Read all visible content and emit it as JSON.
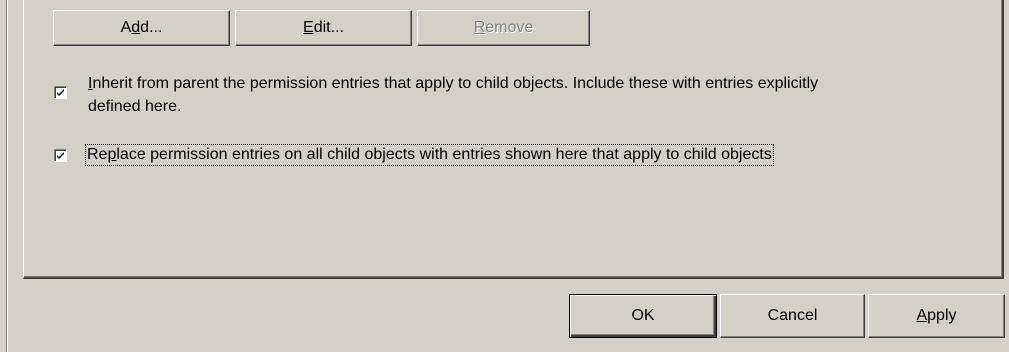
{
  "buttons": {
    "add": {
      "pre": "A",
      "acc": "d",
      "post": "d..."
    },
    "edit": {
      "pre": "",
      "acc": "E",
      "post": "dit..."
    },
    "remove": {
      "pre": "",
      "acc": "R",
      "post": "emove"
    }
  },
  "checkboxes": [
    {
      "checked": true,
      "line1_acc": "I",
      "line1_rest": "nherit from parent the permission entries that apply to child objects. Include these with entries explicitly",
      "line2": "defined here."
    },
    {
      "checked": true,
      "pre": "Re",
      "acc": "p",
      "post": "lace permission entries on all child objects with entries shown here that apply to child objects"
    }
  ],
  "footer": {
    "ok": "OK",
    "cancel": "Cancel",
    "apply_acc": "A",
    "apply_rest": "pply"
  }
}
